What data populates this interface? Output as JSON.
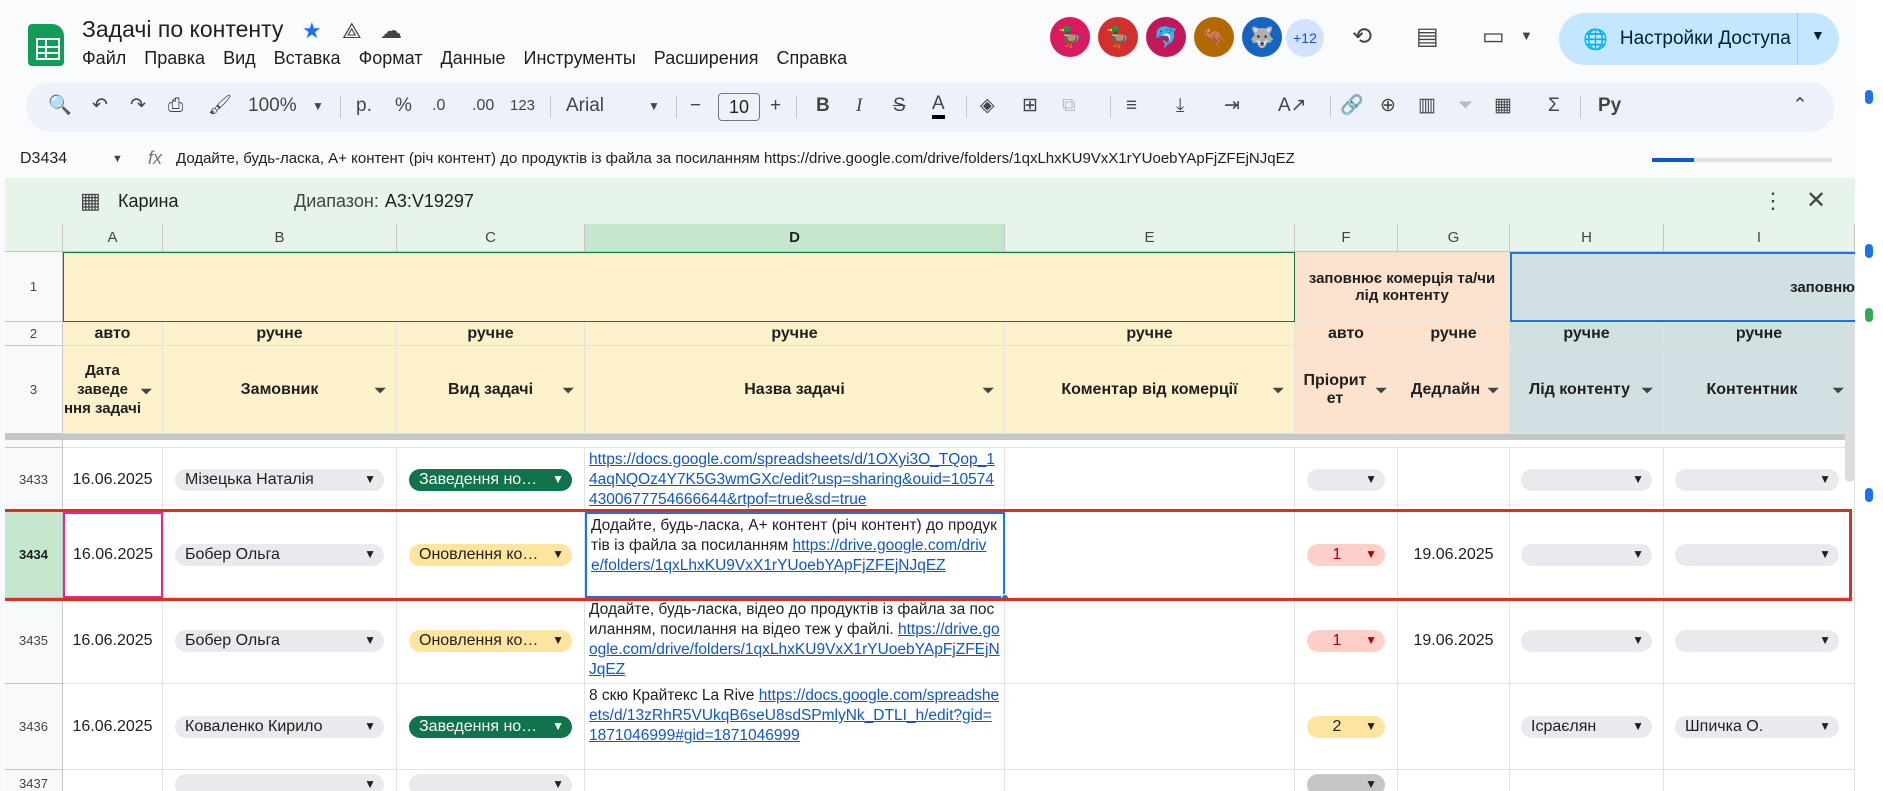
{
  "doc": {
    "title": "Задачі по контенту"
  },
  "menu": [
    "Файл",
    "Правка",
    "Вид",
    "Вставка",
    "Формат",
    "Данные",
    "Инструменты",
    "Расширения",
    "Справка"
  ],
  "collaborators": {
    "extra": "+12"
  },
  "share": {
    "label": "Настройки Доступа"
  },
  "toolbar": {
    "zoom": "100%",
    "currency": "р.",
    "percent": "%",
    "dec_less": ".0",
    "dec_more": ".00",
    "format": "123",
    "font": "Arial",
    "font_size": "10"
  },
  "formula": {
    "cell": "D3434",
    "fx": "fx",
    "text": "Додайте, будь-ласка, A+ контент (річ контент) до продуктів із файла за посиланням https://drive.google.com/drive/folders/1qxLhxKU9VxX1rYUoebYApFjZFEjNJqEZ"
  },
  "filter_view": {
    "name": "Карина",
    "range_label": "Диапазон:",
    "range": "A3:V19297"
  },
  "columns": [
    "A",
    "B",
    "C",
    "D",
    "E",
    "F",
    "G",
    "H",
    "I"
  ],
  "rows": {
    "r1": {
      "num": "1",
      "f": "заповнює комерція та/чи лід контенту",
      "h": "заповню"
    },
    "r2": {
      "num": "2",
      "a": "авто",
      "b": "ручне",
      "c": "ручне",
      "d": "ручне",
      "e": "ручне",
      "f": "авто",
      "g": "ручне",
      "h": "ручне",
      "i": "ручне"
    },
    "r3": {
      "num": "3",
      "a": "Дата заведе ння задачі",
      "b": "Замовник",
      "c": "Вид задачі",
      "d": "Назва задачі",
      "e": "Коментар від комерції",
      "f": "Пріорит ет",
      "g": "Дедлайн",
      "h": "Лід контенту",
      "i": "Контентник"
    }
  },
  "data_rows": [
    {
      "num": "3433",
      "date": "16.06.2025",
      "customer": "Мізецька Наталія",
      "type": "Заведення но…",
      "task_link": "https://docs.google.com/spreadsheets/d/1OXyi3O_TQop_14aqNQOz4Y7K5G3wmGXc/edit?usp=sharing&ouid=105744300677754666644&rtpof=true&sd=true",
      "priority": "",
      "deadline": "",
      "lead": "",
      "content": ""
    },
    {
      "num": "3434",
      "date": "16.06.2025",
      "customer": "Бобер Ольга",
      "type": "Оновлення ко…",
      "task_text": "Додайте, будь-ласка, A+ контент (річ контент) до продуктів із файла за посиланням",
      "task_link": "https://drive.google.com/drive/folders/1qxLhxKU9VxX1rYUoebYApFjZFEjNJqEZ",
      "priority": "1",
      "deadline": "19.06.2025",
      "lead": "",
      "content": ""
    },
    {
      "num": "3435",
      "date": "16.06.2025",
      "customer": "Бобер Ольга",
      "type": "Оновлення ко…",
      "task_text": "Додайте, будь-ласка, відео до продуктів із файла за посиланням, посилання на  відео теж у файлі.",
      "task_link": "https://drive.google.com/drive/folders/1qxLhxKU9VxX1rYUoebYApFjZFEjNJqEZ",
      "priority": "1",
      "deadline": "19.06.2025",
      "lead": "",
      "content": ""
    },
    {
      "num": "3436",
      "date": "16.06.2025",
      "customer": "Коваленко Кирило",
      "type": "Заведення но…",
      "task_text": "8 скю Крайтекс La Rive",
      "task_link": "https://docs.google.com/spreadsheets/d/13zRhR5VUkqB6seU8sdSPmlyNk_DTLI_h/edit?gid=1871046999#gid=1871046999",
      "priority": "2",
      "deadline": "",
      "lead": "Ісраєлян",
      "content": "Шпичка О."
    },
    {
      "num": "3437"
    }
  ],
  "colors": {
    "green_chip": "#11734b",
    "yellow_chip": "#ffe5a0",
    "red_chip": "#ffcfc9",
    "header_green": "#e6f4ea",
    "selection_red": "#d93025"
  }
}
